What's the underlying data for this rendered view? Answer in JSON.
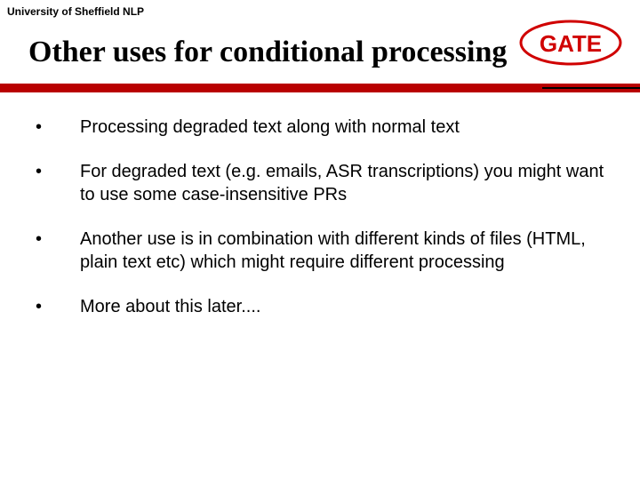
{
  "header": {
    "affiliation": "University of Sheffield NLP",
    "logo_text": "GATE"
  },
  "title": "Other uses for conditional processing",
  "bullets": [
    "Processing degraded text along with normal text",
    "For degraded text (e.g. emails, ASR transcriptions) you might want to use some case-insensitive PRs",
    "Another use is in combination with different kinds of files (HTML, plain text etc) which might require different processing",
    "More about this later...."
  ],
  "colors": {
    "accent_red": "#b90000",
    "logo_red": "#d00000"
  }
}
